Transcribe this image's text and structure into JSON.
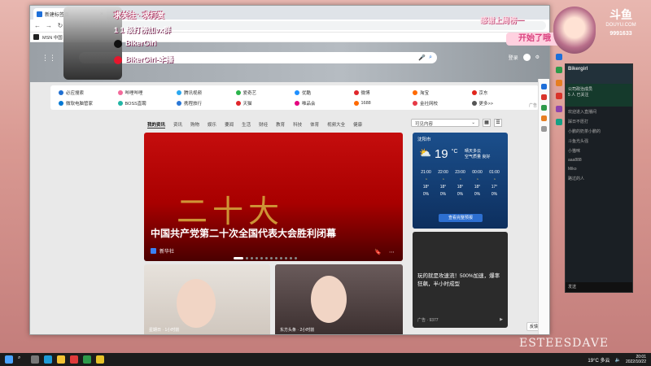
{
  "browser": {
    "tab_title": "新建标签页",
    "url": "",
    "bookmark_label": "MSN 中国"
  },
  "search": {
    "placeholder": "",
    "apps_label": "",
    "user_label": "登录"
  },
  "quicklinks": [
    {
      "label": "必应搜索",
      "color": "#1f6fd1"
    },
    {
      "label": "哔哩哔哩",
      "color": "#f36a9b"
    },
    {
      "label": "腾讯视频",
      "color": "#2aa7f0"
    },
    {
      "label": "爱奇艺",
      "color": "#2ab34a"
    },
    {
      "label": "优酷",
      "color": "#1e90ff"
    },
    {
      "label": "微博",
      "color": "#e0262b"
    },
    {
      "label": "淘宝",
      "color": "#ff6a00"
    },
    {
      "label": "京东",
      "color": "#e1251b"
    },
    {
      "label": "微软电脑管家",
      "color": "#0078d4"
    },
    {
      "label": "BOSS直聘",
      "color": "#22b5a5"
    },
    {
      "label": "携程旅行",
      "color": "#2a77d6"
    },
    {
      "label": "天猫",
      "color": "#e0262b"
    },
    {
      "label": "唯品会",
      "color": "#e4007f"
    },
    {
      "label": "1688",
      "color": "#ff6a00"
    },
    {
      "label": "金社网校",
      "color": "#e63946"
    },
    {
      "label": "更多>>",
      "color": "#555555"
    }
  ],
  "ad_tag": "广告",
  "feed_tabs": [
    "我的资讯",
    "资讯",
    "购物",
    "娱乐",
    "要闻",
    "生活",
    "财经",
    "教育",
    "科技",
    "体育",
    "视频大全",
    "健康"
  ],
  "feed_dropdown": "可见内容",
  "main_news": {
    "big_chars": "二十大",
    "title": "中国共产党第二十次全国代表大会胜利闭幕",
    "source": "新华社"
  },
  "weather": {
    "location": "沈阳市",
    "temp": "19",
    "unit": "°C",
    "desc_line1": "晴天多云",
    "desc_line2": "空气质量 良好",
    "hours": [
      "21:00",
      "22:00",
      "23:00",
      "00:00",
      "01:00"
    ],
    "hour_temps": [
      "18°",
      "18°",
      "18°",
      "18°",
      "17°"
    ],
    "hour_precip": [
      "0%",
      "0%",
      "0%",
      "0%",
      "0%"
    ],
    "button": "查看完整预报"
  },
  "ad_card": {
    "text": "玩的就是攻速流！500%加速，爆率狂飙，半小时成型",
    "footer_left": "广告 · 9377",
    "footer_right": "▶"
  },
  "card2": {
    "source": "星期日 · 1小时前"
  },
  "card3": {
    "source": "东方头条 · 2小时前"
  },
  "feedback": "反馈",
  "overlay": {
    "line1": "求关注 · 求打赏",
    "line2": "1 1 级打榜加vx群",
    "line3": "BikerGirl",
    "line4": "BikerGirl-本播",
    "thanks": "感谢上周榜一",
    "start": "开始了哦",
    "logo": "斗鱼",
    "logo_sub": "DOUYU.COM",
    "room_num": "9991633",
    "watermark": "ESTEESDAVE"
  },
  "chat": {
    "name": "Bikergirl",
    "sub1": "公司政治成员",
    "sub2": "5 人 已关注",
    "messages": [
      "欢迎进入直播间",
      "踩日不愿打",
      "小鹏的奶茶小鹏的",
      "斗鱼光头强",
      "小猫咪",
      "aaa888",
      "Miko",
      "路过的人"
    ],
    "footer": "发送"
  },
  "taskbar": {
    "weather": "19°C 多云",
    "time": "20:01",
    "date": "2022/10/22"
  }
}
